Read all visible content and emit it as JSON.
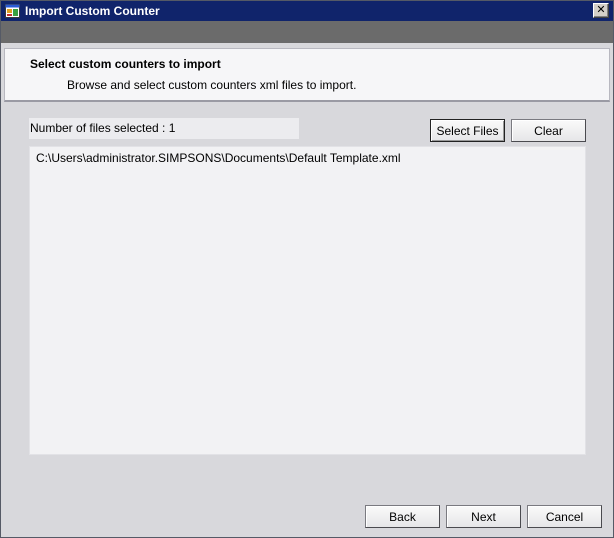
{
  "window": {
    "title": "Import Custom Counter",
    "close_symbol": "✕"
  },
  "header": {
    "title": "Select custom counters to import",
    "subtitle": "Browse and select custom counters xml files to import."
  },
  "files": {
    "count_label": "Number of files selected : 1",
    "select_label": "Select Files",
    "clear_label": "Clear",
    "items": [
      "C:\\Users\\administrator.SIMPSONS\\Documents\\Default Template.xml"
    ]
  },
  "footer": {
    "back_label": "Back",
    "next_label": "Next",
    "cancel_label": "Cancel"
  },
  "colors": {
    "titlebar": "#10246b",
    "dialog_bg": "#d8d8dc",
    "panel_bg": "#f6f6f8"
  },
  "icons": {
    "app": "window-app-icon",
    "close": "close-icon"
  }
}
